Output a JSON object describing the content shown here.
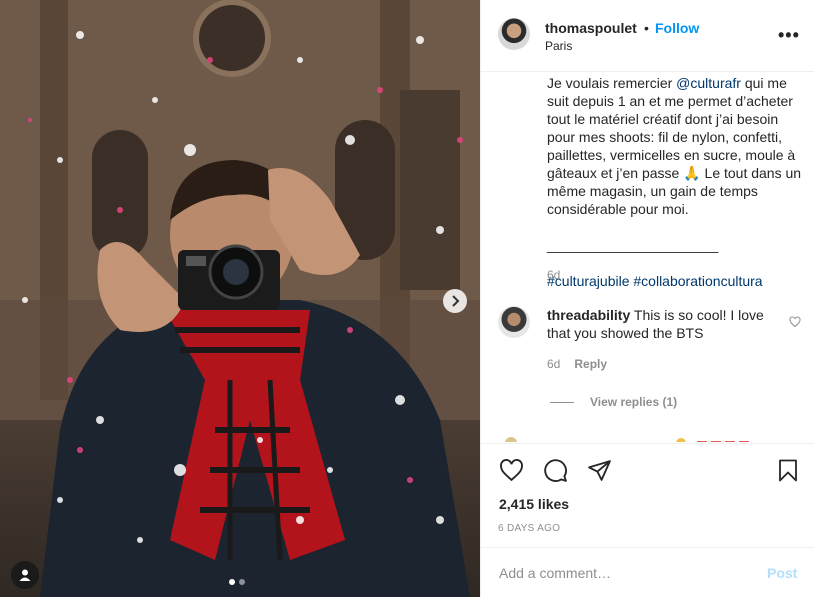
{
  "post": {
    "username": "thomaspoulet",
    "separator": "•",
    "follow_label": "Follow",
    "location": "Paris",
    "more_icon": "more-options-icon"
  },
  "caption": {
    "text_before": "Je voulais remercier ",
    "mention": "@culturafr",
    "text_after": " qui me suit depuis 1 an et me permet d’acheter tout le matériel créatif dont j’ai besoin pour mes shoots: fil de nylon, confetti, paillettes, vermicelles en sucre, moule à gâteaux et j’en passe 🙏 Le tout dans un même magasin, un gain de temps considérable pour moi.",
    "divider": "______________________",
    "hashtags": [
      "#culturajubile",
      "#collaborationcultura"
    ],
    "time": "6d"
  },
  "comments": [
    {
      "username": "threadability",
      "text": "This is so cool! I love that you showed the BTS",
      "time": "6d",
      "reply_label": "Reply",
      "view_replies_label": "View replies (1)"
    }
  ],
  "actions": {
    "icons": [
      "heart-icon",
      "comment-icon",
      "share-icon",
      "bookmark-icon"
    ],
    "likes": "2,415 likes",
    "date": "6 DAYS AGO"
  },
  "composer": {
    "placeholder": "Add a comment…",
    "post_label": "Post"
  },
  "carousel": {
    "slide_count": 2,
    "active_index": 0
  },
  "colors": {
    "link": "#0095f6",
    "mention": "#00376b",
    "muted": "#8e8e8e",
    "post_disabled": "#b2dffc"
  }
}
